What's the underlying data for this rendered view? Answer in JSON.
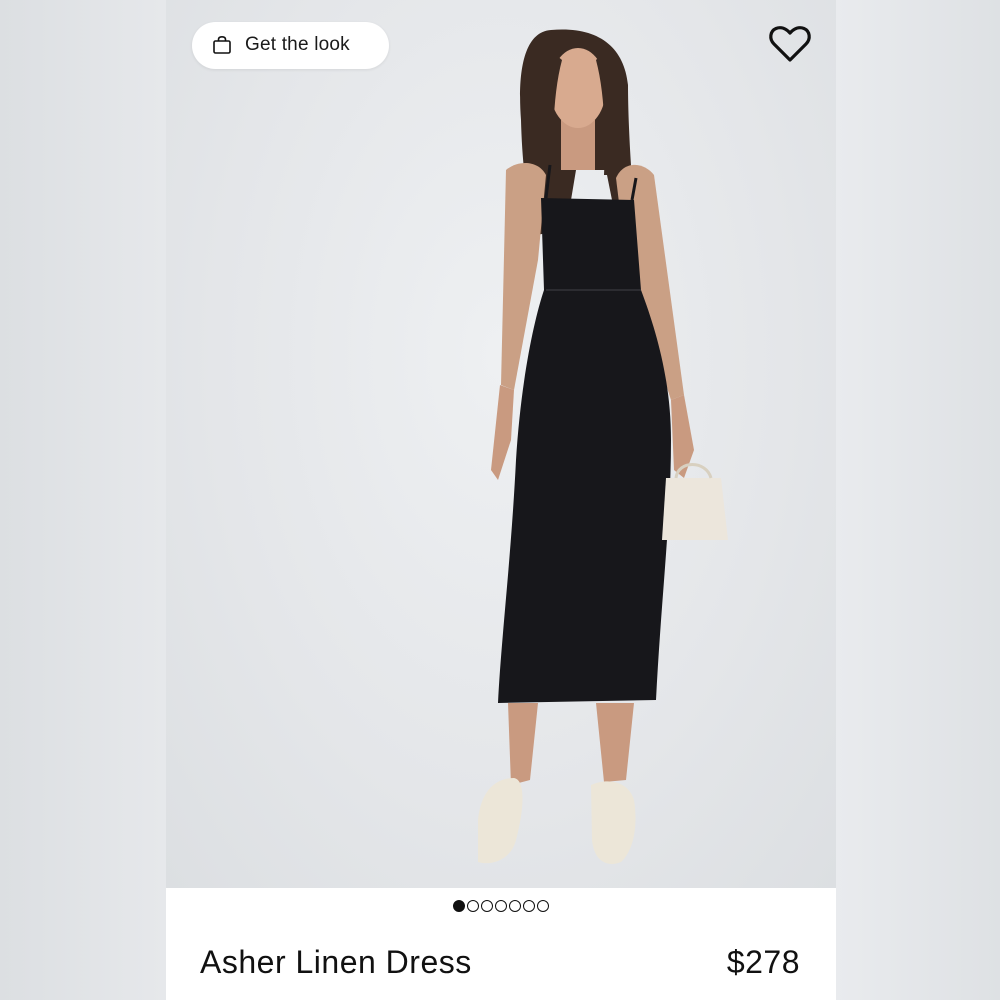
{
  "header": {
    "get_look_label": "Get the look",
    "get_look_icon": "shopping-bag-icon",
    "favorite_icon": "heart-icon"
  },
  "product": {
    "name": "Asher Linen Dress",
    "price": "$278"
  },
  "gallery": {
    "total_images": 7,
    "current_index": 1
  },
  "colors": {
    "dress": "#17171b",
    "background": "#e4e6e9",
    "accent": "#111111"
  }
}
